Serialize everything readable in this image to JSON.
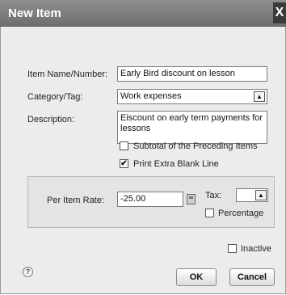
{
  "window": {
    "title": "New Item",
    "close_glyph": "X"
  },
  "form": {
    "item_name_label": "Item Name/Number:",
    "item_name_value": "Early Bird discount on lesson",
    "category_label": "Category/Tag:",
    "category_value": "Work expenses",
    "description_label": "Description:",
    "description_value": "Eiscount on early term payments for lessons",
    "subtotal_label": "Subtotal of the Preceding Items",
    "subtotal_checked": false,
    "print_blank_label": "Print Extra Blank Line",
    "print_blank_checked": true,
    "print_blank_mark": "✔"
  },
  "rate": {
    "per_item_label": "Per Item Rate:",
    "per_item_value": "-25.00",
    "tax_label": "Tax:",
    "tax_value": "",
    "percentage_label": "Percentage",
    "percentage_checked": false
  },
  "footer": {
    "inactive_label": "Inactive",
    "inactive_checked": false,
    "help_glyph": "?",
    "ok_label": "OK",
    "cancel_label": "Cancel"
  },
  "icons": {
    "dropdown_glyph": "▲",
    "calculator_icon": "calculator-icon"
  }
}
